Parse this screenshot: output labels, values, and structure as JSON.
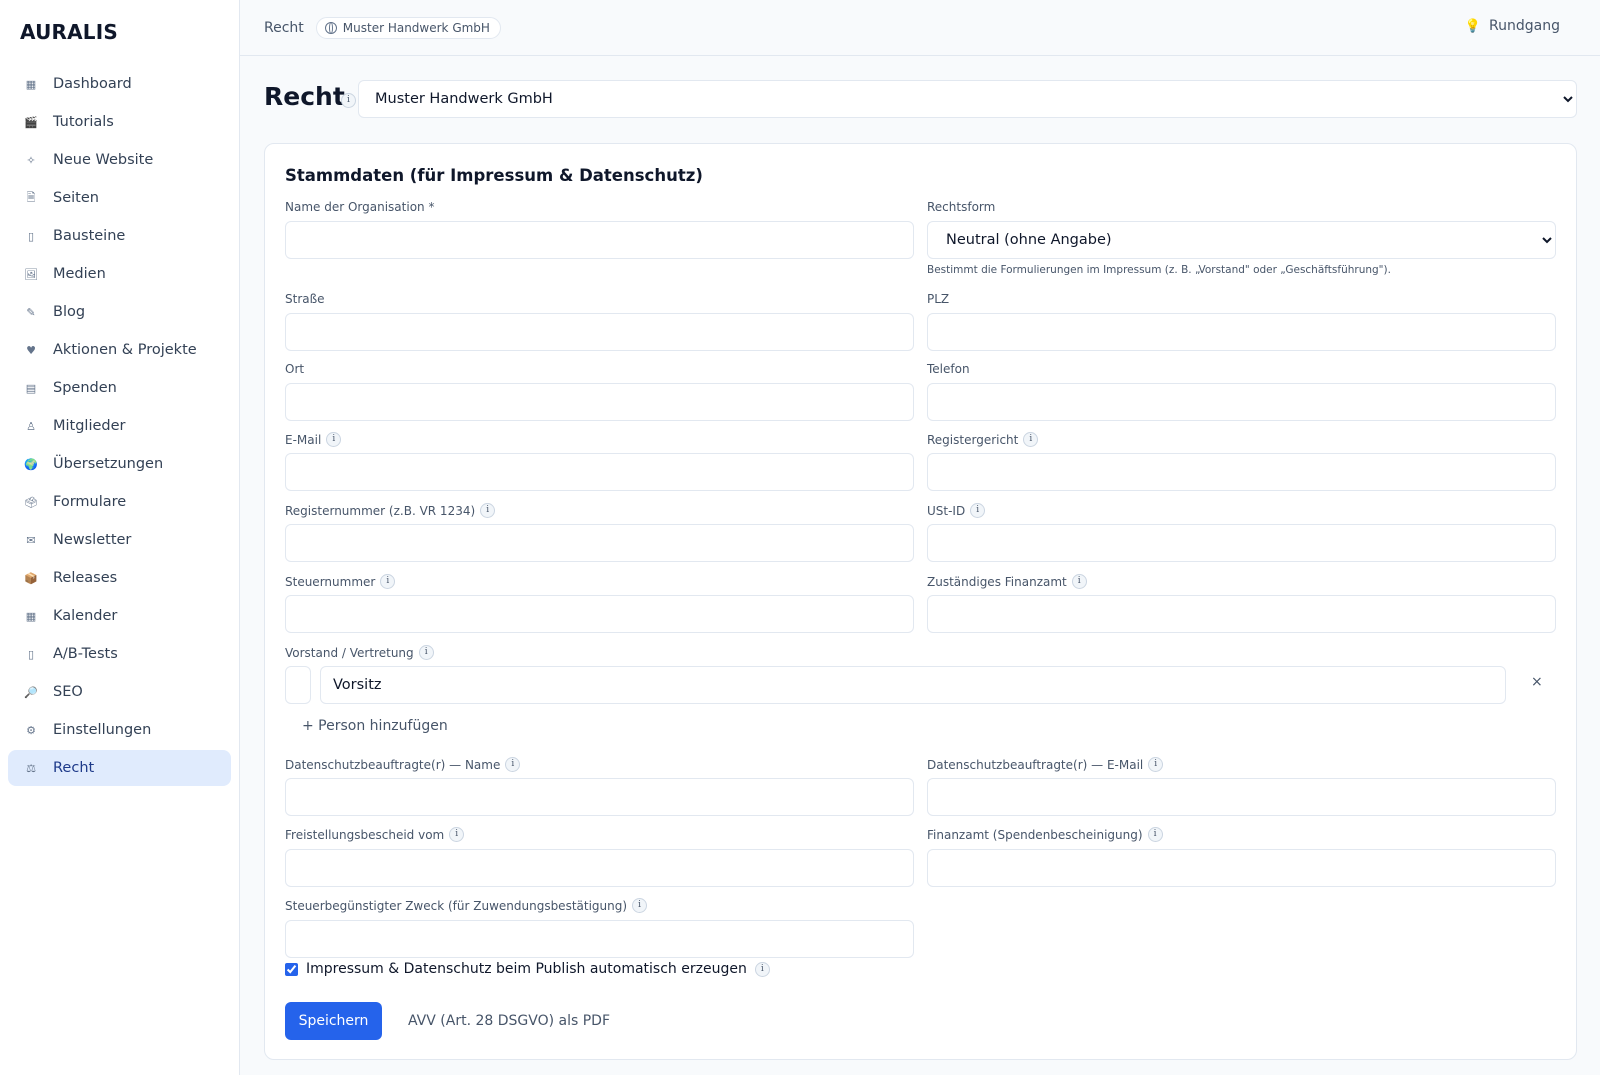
{
  "app": {
    "logo": "AURALIS"
  },
  "sidebar": {
    "items": [
      {
        "label": "Dashboard",
        "icon": "dashboard-icon",
        "glyph": "▦"
      },
      {
        "label": "Tutorials",
        "icon": "clapper-icon",
        "glyph": "🎬"
      },
      {
        "label": "Neue Website",
        "icon": "sparkle-icon",
        "glyph": "✧"
      },
      {
        "label": "Seiten",
        "icon": "page-icon",
        "glyph": "🗎"
      },
      {
        "label": "Bausteine",
        "icon": "block-icon",
        "glyph": "▯"
      },
      {
        "label": "Medien",
        "icon": "image-icon",
        "glyph": "🖼"
      },
      {
        "label": "Blog",
        "icon": "pen-icon",
        "glyph": "✎"
      },
      {
        "label": "Aktionen & Projekte",
        "icon": "heart-icon",
        "glyph": "♥"
      },
      {
        "label": "Spenden",
        "icon": "card-icon",
        "glyph": "▤"
      },
      {
        "label": "Mitglieder",
        "icon": "members-icon",
        "glyph": "♙"
      },
      {
        "label": "Übersetzungen",
        "icon": "globe-icon",
        "glyph": "🌍"
      },
      {
        "label": "Formulare",
        "icon": "form-icon",
        "glyph": "🗳"
      },
      {
        "label": "Newsletter",
        "icon": "mail-icon",
        "glyph": "✉"
      },
      {
        "label": "Releases",
        "icon": "package-icon",
        "glyph": "📦"
      },
      {
        "label": "Kalender",
        "icon": "calendar-icon",
        "glyph": "▦"
      },
      {
        "label": "A/B-Tests",
        "icon": "test-icon",
        "glyph": "▯"
      },
      {
        "label": "SEO",
        "icon": "magnifier-icon",
        "glyph": "🔎"
      },
      {
        "label": "Einstellungen",
        "icon": "gear-icon",
        "glyph": "⚙"
      },
      {
        "label": "Recht",
        "icon": "scales-icon",
        "glyph": "⚖",
        "active": true
      }
    ]
  },
  "topbar": {
    "breadcrumb": "Recht",
    "org_pill": "Muster Handwerk GmbH",
    "tour": "Rundgang"
  },
  "page": {
    "title": "Recht",
    "info": "i",
    "org_select": "Muster Handwerk GmbH"
  },
  "form": {
    "title": "Stammdaten (für Impressum & Datenschutz)",
    "labels": {
      "name": "Name der Organisation *",
      "rechtsform": "Rechtsform",
      "strasse": "Straße",
      "plz": "PLZ",
      "ort": "Ort",
      "telefon": "Telefon",
      "email": "E-Mail",
      "registergericht": "Registergericht",
      "registernummer": "Registernummer (z.B. VR 1234)",
      "ustid": "USt-ID",
      "steuernummer": "Steuernummer",
      "finanzamt": "Zuständiges Finanzamt",
      "vorstand": "Vorstand / Vertretung",
      "dsb_name": "Datenschutzbeauftragte(r) — Name",
      "dsb_email": "Datenschutzbeauftragte(r) — E-Mail",
      "freistellung": "Freistellungsbescheid vom",
      "finanzamt_spenden": "Finanzamt (Spendenbescheinigung)",
      "zweck": "Steuerbegünstigter Zweck (für Zuwendungsbestätigung)"
    },
    "values": {
      "name": "",
      "rechtsform": "Neutral (ohne Angabe)",
      "strasse": "",
      "plz": "",
      "ort": "",
      "telefon": "",
      "email": "",
      "registergericht": "",
      "registernummer": "",
      "ustid": "",
      "steuernummer": "",
      "finanzamt": "",
      "vorstand_role": "Vorsitz",
      "dsb_name": "",
      "dsb_email": "",
      "freistellung": "",
      "finanzamt_spenden": "",
      "zweck": ""
    },
    "rechtsform_hint": "Bestimmt die Formulierungen im Impressum (z. B. „Vorstand\" oder „Geschäftsführung\").",
    "remove_person": "×",
    "add_person": "+ Person hinzufügen",
    "auto_generate": "Impressum & Datenschutz beim Publish automatisch erzeugen",
    "auto_generate_checked": true,
    "save": "Speichern",
    "avv_link": "AVV (Art. 28 DSGVO) als PDF"
  },
  "colors": {
    "accent": "#2563eb",
    "active_nav_bg": "#e0ebfd"
  }
}
